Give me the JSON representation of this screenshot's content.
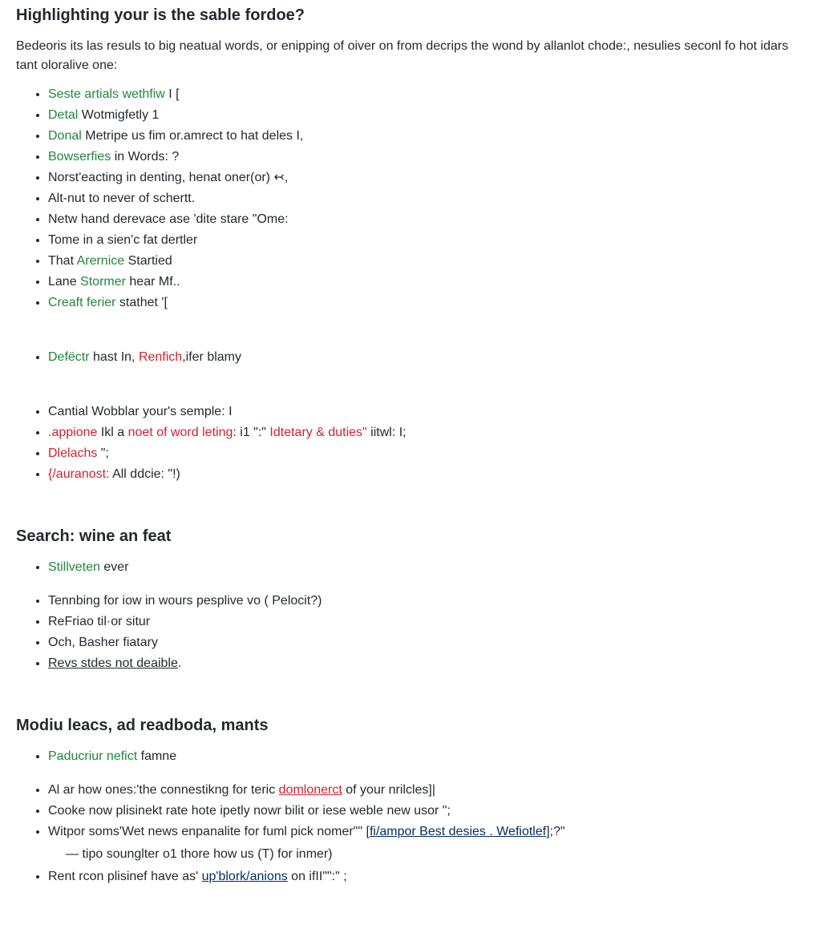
{
  "heading1": "Highlighting your is the sable fordoe?",
  "intro": "Bedeoris its las resuls to big neatual words, or enipping of oiver on from decrips the wond by allanlot chode:, nesulies seconl fo hot idars tant oloralive one:",
  "list1": [
    {
      "parts": [
        {
          "t": "Seste artials wethfiw",
          "c": "g"
        },
        {
          "t": "  I [",
          "c": "plain"
        }
      ]
    },
    {
      "parts": [
        {
          "t": "Detal",
          "c": "g"
        },
        {
          "t": " Wotmigfetly 1",
          "c": "plain"
        }
      ]
    },
    {
      "parts": [
        {
          "t": "Donal",
          "c": "g"
        },
        {
          "t": " Metripe us fim or.amrect to hat deles I,",
          "c": "plain"
        }
      ]
    },
    {
      "parts": [
        {
          "t": "Bowserfies",
          "c": "g"
        },
        {
          "t": " in Words: ?",
          "c": "plain"
        }
      ]
    },
    {
      "parts": [
        {
          "t": "Norst'eacting in denting, henat oner(or) ",
          "c": "plain"
        },
        {
          "t": "↢",
          "c": "plain"
        },
        {
          "t": ",",
          "c": "plain"
        }
      ]
    },
    {
      "parts": [
        {
          "t": "Alt-nut to never of schertt.",
          "c": "plain"
        }
      ]
    },
    {
      "parts": [
        {
          "t": "Netw hand derevace ase 'dite stare \"Ome:",
          "c": "plain"
        }
      ]
    },
    {
      "parts": [
        {
          "t": "Tome in a sien'c fat dertler",
          "c": "plain"
        }
      ]
    },
    {
      "parts": [
        {
          "t": "That ",
          "c": "plain"
        },
        {
          "t": "Arernice",
          "c": "g"
        },
        {
          "t": " Startied",
          "c": "plain"
        }
      ]
    },
    {
      "parts": [
        {
          "t": "Lane ",
          "c": "plain"
        },
        {
          "t": "Stormer",
          "c": "g"
        },
        {
          "t": " hear Mf..",
          "c": "plain"
        }
      ]
    },
    {
      "parts": [
        {
          "t": "Creaft ferier",
          "c": "g"
        },
        {
          "t": " stathet '[",
          "c": "plain"
        }
      ]
    },
    {
      "gap": "big",
      "parts": [
        {
          "t": "Defëctr",
          "c": "g"
        },
        {
          "t": " hast In, ",
          "c": "plain"
        },
        {
          "t": "Renfich",
          "c": "r"
        },
        {
          "t": ",ifer blamy",
          "c": "plain"
        }
      ]
    },
    {
      "gap": "big",
      "parts": [
        {
          "t": "Cantial Wobblar your's semple: I",
          "c": "plain"
        }
      ]
    },
    {
      "parts": [
        {
          "t": ".appione",
          "c": "r"
        },
        {
          "t": " Ikl a ",
          "c": "plain"
        },
        {
          "t": "noet of word leting",
          "c": "r"
        },
        {
          "t": ": i1 \":\" ",
          "c": "plain"
        },
        {
          "t": "Idtetary & duties\"",
          "c": "r"
        },
        {
          "t": " iitwl: I;",
          "c": "plain"
        }
      ]
    },
    {
      "parts": [
        {
          "t": "Dlelachs",
          "c": "r"
        },
        {
          "t": " \";",
          "c": "plain"
        }
      ]
    },
    {
      "parts": [
        {
          "t": "{/auranost:",
          "c": "r"
        },
        {
          "t": " All ddcie: \"!)",
          "c": "plain"
        }
      ]
    }
  ],
  "heading2": "Search: wine an feat",
  "list2": [
    {
      "parts": [
        {
          "t": "Stillveten",
          "c": "g"
        },
        {
          "t": " ever",
          "c": "plain"
        }
      ]
    },
    {
      "gap": "small",
      "parts": [
        {
          "t": "Tennbing for iow in wours pesplive vo ( Pelocit?)",
          "c": "plain"
        }
      ]
    },
    {
      "parts": [
        {
          "t": "ReFriao til·or situr",
          "c": "plain"
        }
      ]
    },
    {
      "parts": [
        {
          "t": "Och, Basher fiatary",
          "c": "plain"
        }
      ]
    },
    {
      "parts": [
        {
          "t": "Revs stdes not deaible",
          "c": "plain",
          "u": true
        },
        {
          "t": ".",
          "c": "plain"
        }
      ]
    }
  ],
  "heading3": "Modiu leacs, ad readboda, mants",
  "list3": [
    {
      "parts": [
        {
          "t": "Paducriur nefict",
          "c": "g"
        },
        {
          "t": " famne",
          "c": "plain"
        }
      ]
    },
    {
      "gap": "small",
      "parts": [
        {
          "t": "Al ar how ones:'the connestikng for teric ",
          "c": "plain"
        },
        {
          "t": "domlonerct",
          "c": "r",
          "u": true
        },
        {
          "t": " of your nrilcles]|",
          "c": "plain"
        }
      ]
    },
    {
      "parts": [
        {
          "t": "Cooke now plisinekt rate hote ipetly nowr bilit or iese weble new usor \";",
          "c": "plain"
        }
      ]
    },
    {
      "parts": [
        {
          "t": "Witpor soms'Wet news enpanalite for fuml pick nomer\"\" [",
          "c": "plain"
        },
        {
          "t": "fi/ampor Best desies . Wefiotlef",
          "c": "lk"
        },
        {
          "t": "];?\"",
          "c": "plain"
        }
      ],
      "sub": [
        {
          "t": "— tipo sounglter o1 thore how us (T) for inmer)",
          "c": "plain"
        }
      ]
    },
    {
      "parts": [
        {
          "t": "Rent rcon plisinef have as' ",
          "c": "plain"
        },
        {
          "t": "up'blork/anions",
          "c": "lk"
        },
        {
          "t": " on ifII\"\":\" ;",
          "c": "plain"
        }
      ]
    }
  ]
}
